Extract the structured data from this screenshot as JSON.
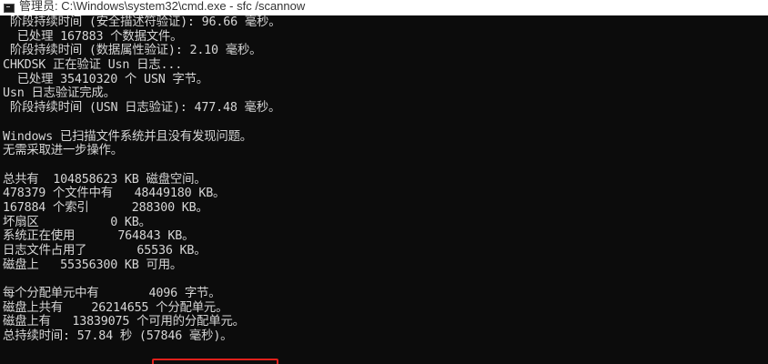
{
  "window": {
    "title": "管理员: C:\\Windows\\system32\\cmd.exe - sfc  /scannow",
    "icon": "cmd-icon"
  },
  "console": {
    "lines": [
      " 阶段持续时间 (安全描述符验证): 96.66 毫秒。",
      "  已处理 167883 个数据文件。",
      " 阶段持续时间 (数据属性验证): 2.10 毫秒。",
      "CHKDSK 正在验证 Usn 日志...",
      "  已处理 35410320 个 USN 字节。",
      "Usn 日志验证完成。",
      " 阶段持续时间 (USN 日志验证): 477.48 毫秒。",
      "",
      "Windows 已扫描文件系统并且没有发现问题。",
      "无需采取进一步操作。",
      "",
      "总共有  104858623 KB 磁盘空间。",
      "478379 个文件中有   48449180 KB。",
      "167884 个索引      288300 KB。",
      "坏扇区          0 KB。",
      "系统正在使用      764843 KB。",
      "日志文件占用了       65536 KB。",
      "磁盘上   55356300 KB 可用。",
      "",
      "每个分配单元中有       4096 字节。",
      "磁盘上共有    26214655 个分配单元。",
      "磁盘上有   13839075 个可用的分配单元。",
      "总持续时间: 57.84 秒 (57846 毫秒)。"
    ]
  },
  "colors": {
    "console_bg": "#0c0c0c",
    "console_text": "#d6d6d6",
    "titlebar_bg": "#ffffff",
    "highlight": "#e0201b"
  }
}
